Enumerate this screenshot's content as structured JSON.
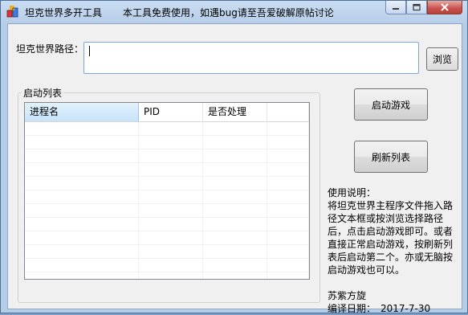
{
  "window": {
    "title": "坦克世界多开工具",
    "notice": "本工具免费使用，如遇bug请至吾爱破解原帖讨论",
    "accent_close": "#c75050"
  },
  "form": {
    "path_label": "坦克世界路径：",
    "path_value": "",
    "browse_label": "浏览"
  },
  "process_list": {
    "group_title": "启动列表",
    "columns": [
      "进程名",
      "PID",
      "是否处理",
      ""
    ],
    "rows": []
  },
  "buttons": {
    "launch_label": "启动游戏",
    "refresh_label": "刷新列表"
  },
  "info": {
    "title": "使用说明：",
    "body": "将坦克世界主程序文件拖入路径文本框或按浏览选择路径后，点击启动游戏即可。或者直接正常启动游戏，按刷新列表后启动第二个。亦或无脑按启动游戏也可以。",
    "author": "苏紫方旋",
    "date_label": "编译日期：",
    "date_value": "2017-7-30"
  }
}
